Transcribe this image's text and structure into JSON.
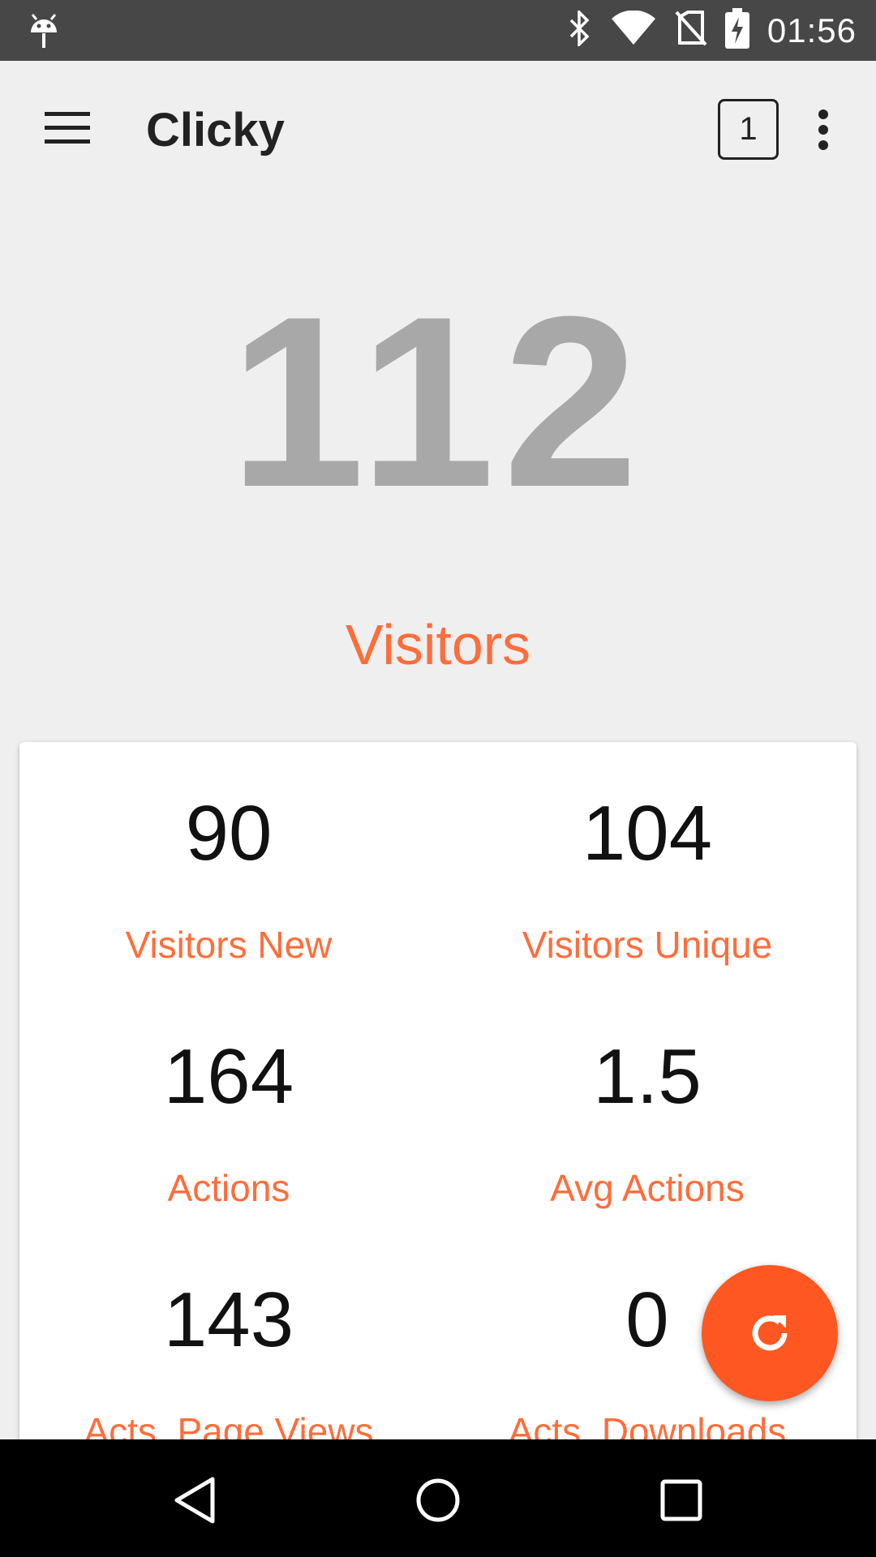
{
  "status_bar": {
    "time": "01:56",
    "icons": [
      "android-notification-icon",
      "bluetooth-icon",
      "wifi-icon",
      "no-sim-icon",
      "battery-charging-icon"
    ]
  },
  "app_bar": {
    "title": "Clicky",
    "badge_count": "1",
    "icons": [
      "menu-icon",
      "more-vert-icon"
    ]
  },
  "hero": {
    "value": "112",
    "label": "Visitors"
  },
  "stats": [
    {
      "value": "90",
      "label": "Visitors New"
    },
    {
      "value": "104",
      "label": "Visitors Unique"
    },
    {
      "value": "164",
      "label": "Actions"
    },
    {
      "value": "1.5",
      "label": "Avg Actions"
    },
    {
      "value": "143",
      "label": "Acts. Page Views"
    },
    {
      "value": "0",
      "label": "Acts. Downloads"
    }
  ],
  "fab": {
    "icon": "refresh-icon"
  },
  "nav_bar": {
    "icons": [
      "back-icon",
      "home-icon",
      "recents-icon"
    ]
  },
  "colors": {
    "accent": "#ff6d3b",
    "fab": "#ff5722",
    "hero_number": "#a8a8a8",
    "status_bar": "#474747",
    "background": "#efefef"
  }
}
